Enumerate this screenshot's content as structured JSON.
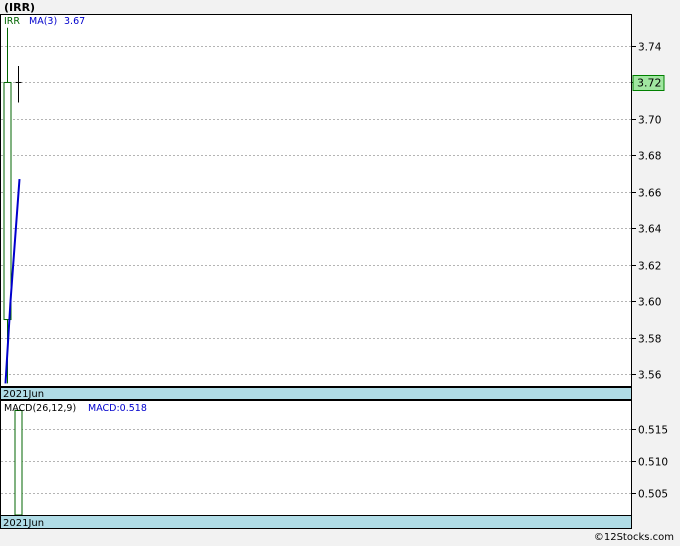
{
  "title": "(IRR)",
  "watermark": "©12Stocks.com",
  "colors": {
    "candle": "#006400",
    "ma_line": "#0000cc",
    "macd_bar": "#006400",
    "band": "#b0dce6",
    "last_price_bg": "#a0e6a0",
    "grid": "#b4b4b4"
  },
  "chart_data": [
    {
      "type": "candlestick",
      "legend": [
        {
          "label": "IRR",
          "color": "#006400"
        },
        {
          "label": "MA(3)",
          "color": "#0000cc"
        },
        {
          "label": "3.67",
          "color": "#0000cc"
        }
      ],
      "ylim": [
        3.553,
        3.757
      ],
      "y_ticks": [
        "3.74",
        "3.72",
        "3.70",
        "3.68",
        "3.66",
        "3.64",
        "3.62",
        "3.60",
        "3.58",
        "3.56"
      ],
      "x_label": "2021Jun",
      "last_price": "3.72",
      "candles": [
        {
          "open": 3.59,
          "close": 3.72,
          "high": 3.75,
          "low": 3.555,
          "direction": "up"
        },
        {
          "open": 3.718,
          "close": 3.72,
          "high": 3.729,
          "low": 3.709,
          "direction": "flat"
        }
      ],
      "ma": {
        "name": "MA(3)",
        "values": [
          3.555,
          3.6,
          3.667
        ]
      }
    },
    {
      "type": "bar",
      "legend": [
        {
          "label": "MACD(26,12,9)",
          "color": "#000000"
        },
        {
          "label": "MACD:0.518",
          "color": "#0000cc"
        }
      ],
      "ylim": [
        0.5015,
        0.5195
      ],
      "y_ticks": [
        "0.515",
        "0.510",
        "0.505"
      ],
      "x_label": "2021Jun",
      "values": [
        0.518
      ]
    }
  ]
}
